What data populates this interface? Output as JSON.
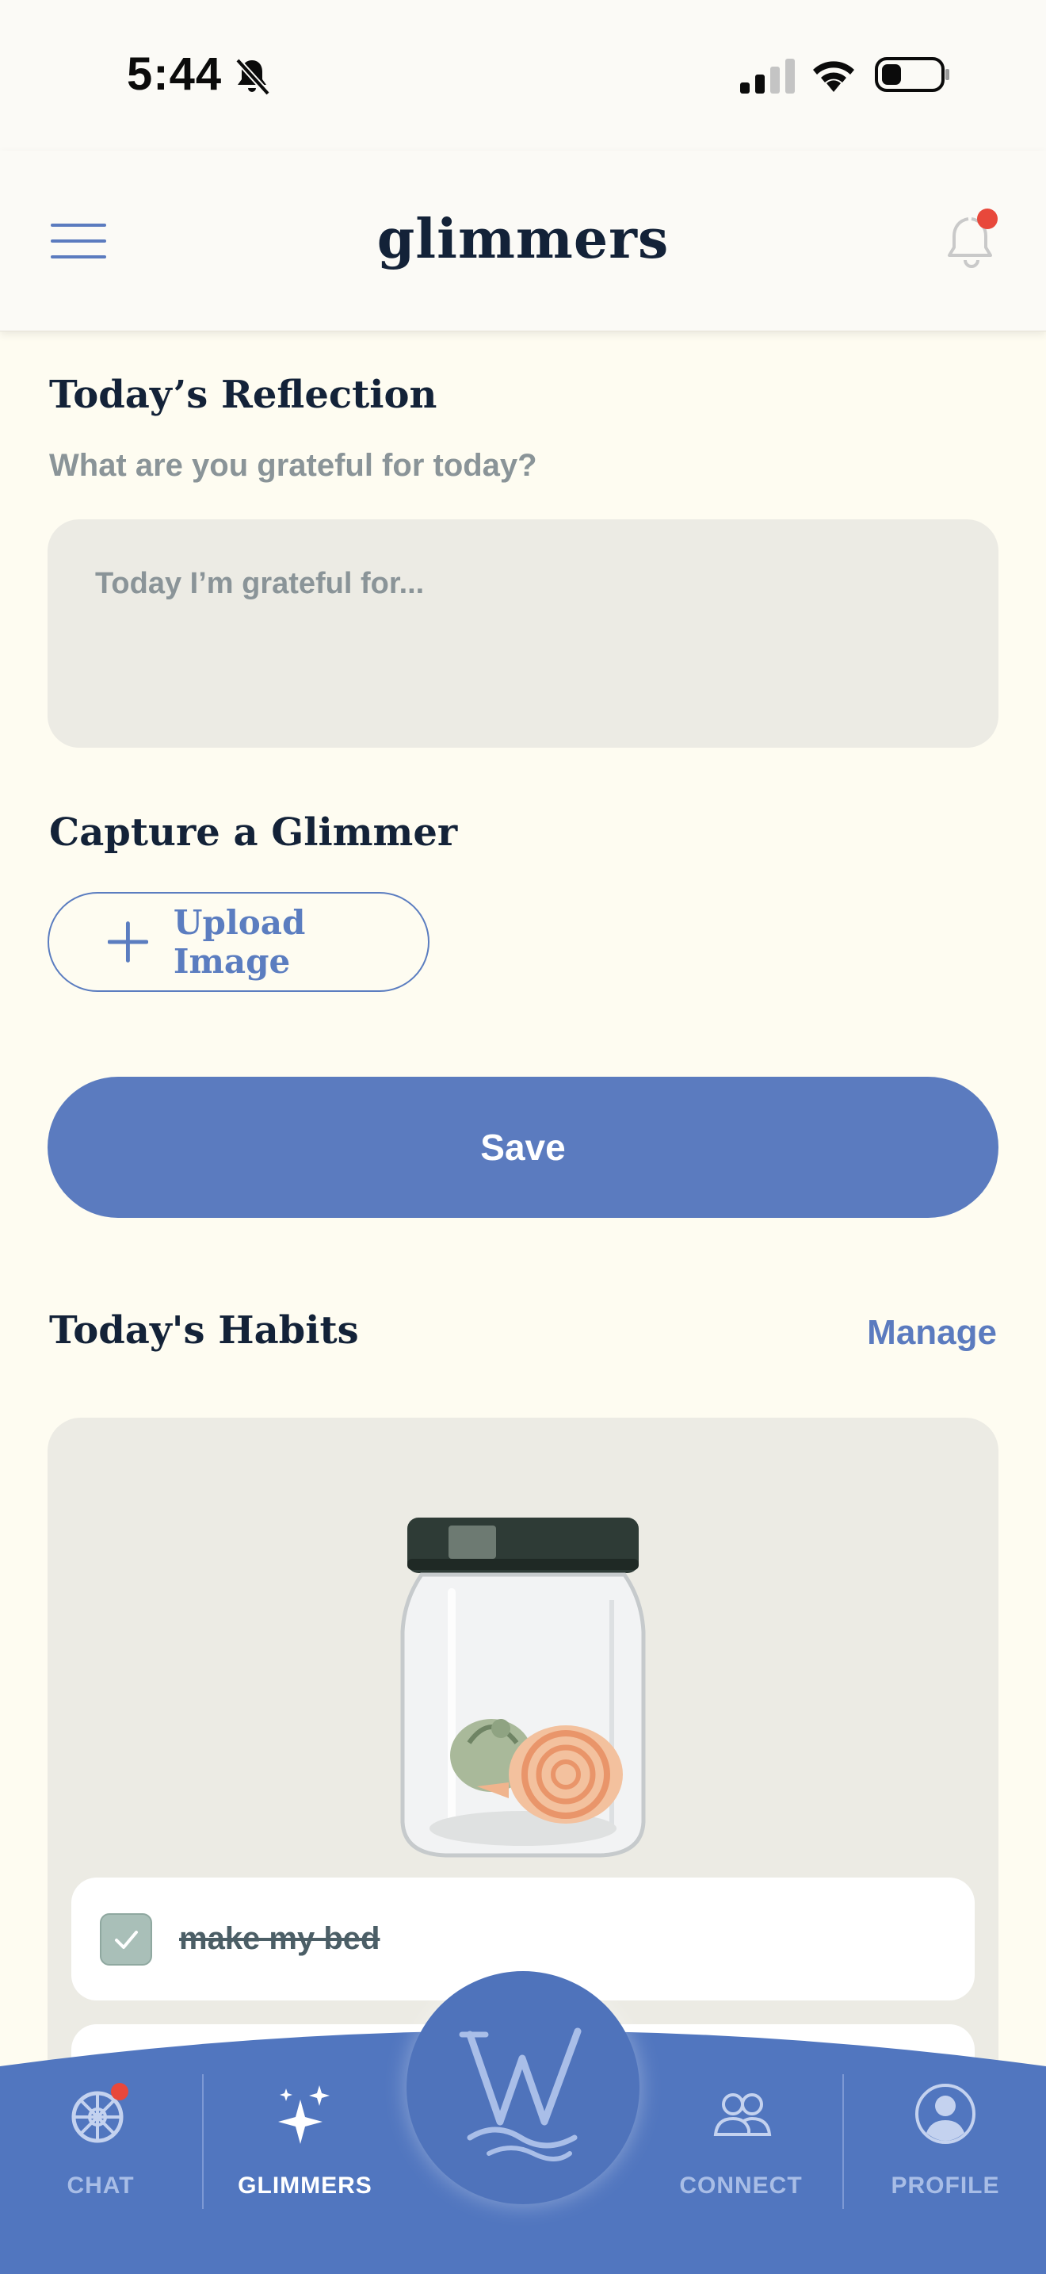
{
  "status_bar": {
    "time": "5:44",
    "icons": [
      "bell-slash-icon",
      "signal-icon",
      "wifi-icon",
      "battery-icon"
    ]
  },
  "header": {
    "title": "glimmers",
    "icons": [
      "menu-icon",
      "notification-bell-icon"
    ],
    "notification_dot_color": "#e8483b"
  },
  "reflection": {
    "heading": "Today’s Reflection",
    "subtitle": "What are you grateful for today?",
    "placeholder": "Today I’m grateful for..."
  },
  "glimmer": {
    "heading": "Capture a Glimmer",
    "upload_label": "Upload Image"
  },
  "save_label": "Save",
  "habits": {
    "heading": "Today's Habits",
    "manage_label": "Manage",
    "items": [
      {
        "label": "make my bed",
        "completed": true
      }
    ]
  },
  "bottom_nav": {
    "items": [
      {
        "label": "CHAT",
        "icon": "chat-wheel-icon",
        "badge": true
      },
      {
        "label": "GLIMMERS",
        "icon": "sparkles-icon",
        "active": true
      },
      {
        "label": "CONNECT",
        "icon": "people-icon"
      },
      {
        "label": "PROFILE",
        "icon": "profile-icon"
      }
    ],
    "home_icon": "w-logo-icon"
  },
  "colors": {
    "accent": "#5b7bbf",
    "background": "#fefcf1",
    "nav": "#5176bf",
    "badge": "#e8483b"
  }
}
